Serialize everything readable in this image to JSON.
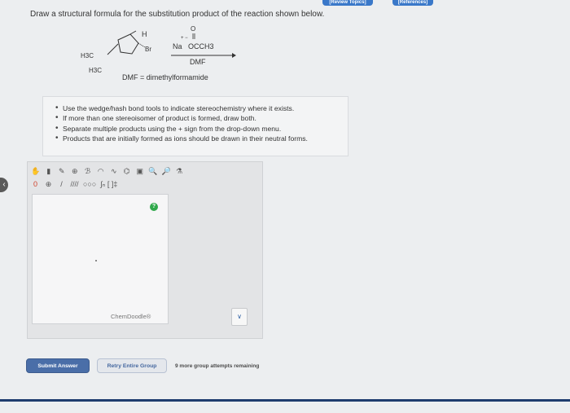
{
  "top_links": {
    "review_topics": "[Review Topics]",
    "references": "[References]"
  },
  "question": "Draw a structural formula for the substitution product of the reaction shown below.",
  "reaction": {
    "h_label": "H",
    "br_label": "Br",
    "ch3_upper": "H3C",
    "ch3_lower": "H3C",
    "reagent_cation": "Na",
    "reagent_charges": "+ −",
    "reagent_oxygen": "O",
    "reagent_anion": "OCCH3",
    "solvent": "DMF",
    "dmf_def": "DMF = dimethylformamide"
  },
  "instructions": [
    "Use the wedge/hash bond tools to indicate stereochemistry where it exists.",
    "If more than one stereoisomer of product is formed, draw both.",
    "Separate multiple products using the + sign from the drop-down menu.",
    "Products that are initially formed as ions should be drawn in their neutral forms."
  ],
  "editor": {
    "tools_row1": [
      "hand-icon",
      "eraser-icon",
      "pencil-icon",
      "plus-circle-icon",
      "text-icon",
      "lasso-icon",
      "chain-icon",
      "template-icon",
      "copy-icon",
      "zoom-in-icon",
      "zoom-out-icon",
      "flask-icon"
    ],
    "tools_row2": [
      "0",
      "⊕",
      "/",
      "////",
      "○○○",
      "∫ₙ [ ]‡"
    ],
    "help": "?",
    "brand": "ChemDoodle®",
    "dropdown_icon": "chevron-down-icon"
  },
  "buttons": {
    "submit": "Submit Answer",
    "retry": "Retry Entire Group"
  },
  "attempts": "9 more group attempts remaining",
  "colors": {
    "primary": "#4a6ea8",
    "help_green": "#2fa84a",
    "nav": "#1e3c6e"
  }
}
